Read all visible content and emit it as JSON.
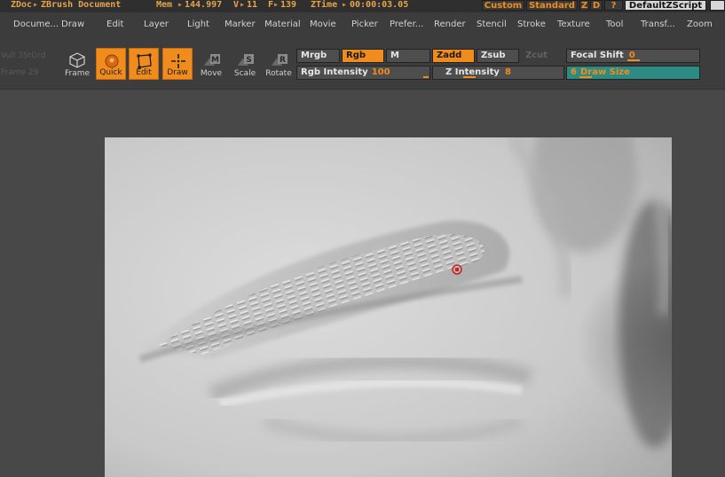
{
  "titlebar": {
    "zdoc": "ZDoc",
    "zbrush_document": "ZBrush Document",
    "mem_label": "Mem",
    "mem_value": "144.997",
    "v_label": "V",
    "v_value": "11",
    "f_label": "F",
    "f_value": "139",
    "ztime_label": "ZTime",
    "ztime_value": "00:00:03.05",
    "custom": "Custom",
    "standard": "Standard",
    "z": "Z",
    "d": "D",
    "help": "?",
    "zscript": "DefaultZScript"
  },
  "menu": [
    "Docume...",
    "Draw",
    "Edit",
    "Layer",
    "Light",
    "Marker",
    "Material",
    "Movie",
    "Picker",
    "Prefer...",
    "Render",
    "Stencil",
    "Stroke",
    "Texture",
    "Tool",
    "Transf...",
    "Zoom"
  ],
  "toolbar": {
    "ghost_top": "Vull   3StGrd",
    "ghost_bottom": "Frame 29",
    "tools": {
      "frame": "Frame",
      "quick": "Quick",
      "edit": "Edit",
      "draw": "Draw",
      "move": "Move",
      "scale": "Scale",
      "rotate": "Rotate"
    },
    "mrgb": "Mrgb",
    "rgb": "Rgb",
    "m": "M",
    "zadd": "Zadd",
    "zsub": "Zsub",
    "zcut": "Zcut",
    "rgb_intensity_label": "Rgb Intensity",
    "rgb_intensity_value": "100",
    "z_intensity_label": "Z Intensity",
    "z_intensity_value": "8",
    "focal_shift_label": "Focal Shift",
    "focal_shift_value": "0",
    "draw_size_value": "6",
    "draw_size_label": "Draw Size"
  },
  "colors": {
    "accent": "#f08c1e",
    "teal": "#2c8c84"
  }
}
